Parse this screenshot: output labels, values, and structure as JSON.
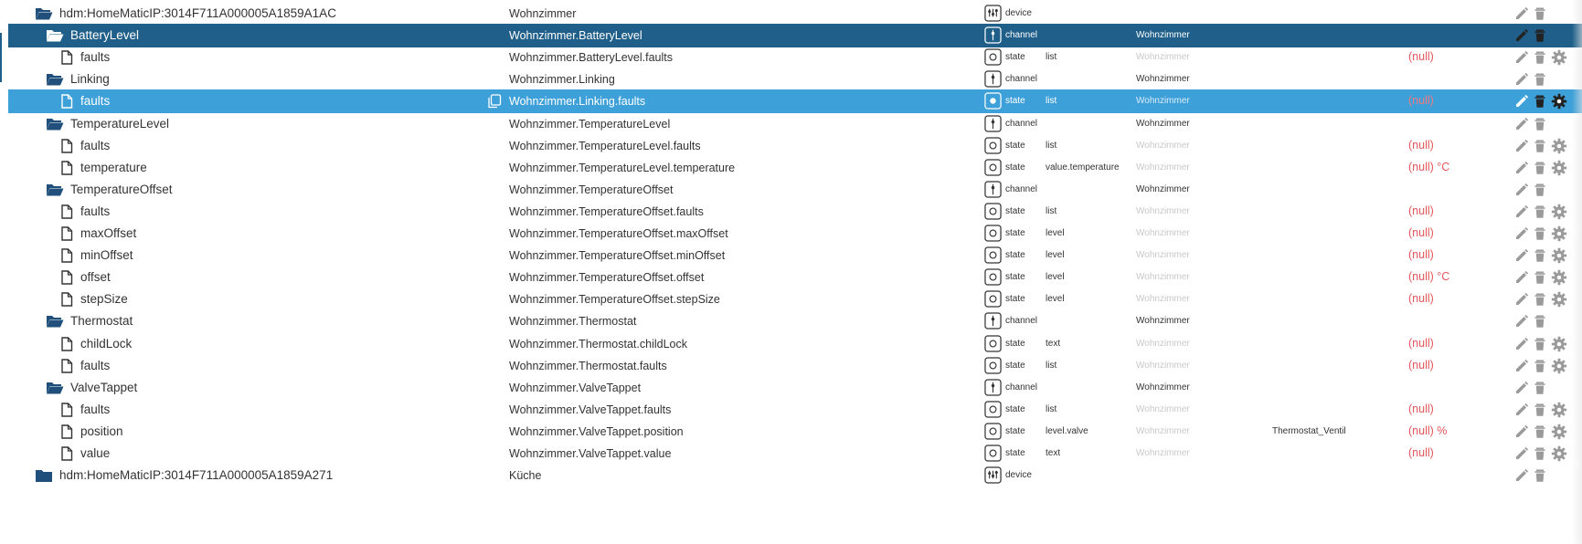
{
  "colors": {
    "selected_dark": "#1f5f89",
    "selected_light": "#3ea0d8",
    "folder": "#1f4f7a",
    "null_value": "#e3565a",
    "muted_icon": "#9a9a9a"
  },
  "rows": [
    {
      "kind": "device-open",
      "level": 0,
      "name": "hdm:HomeMaticIP:3014F711A000005A1859A1AC",
      "obj": "Wohnzimmer",
      "type": "device",
      "role": "",
      "room": "",
      "room_dim": false,
      "func": "",
      "value": "",
      "actions": "ed"
    },
    {
      "kind": "folder-open",
      "level": 1,
      "name": "BatteryLevel",
      "obj": "Wohnzimmer.BatteryLevel",
      "type": "channel",
      "role": "",
      "room": "Wohnzimmer",
      "room_dim": false,
      "func": "",
      "value": "",
      "actions": "ed",
      "selected": "dark"
    },
    {
      "kind": "file",
      "level": 2,
      "name": "faults",
      "obj": "Wohnzimmer.BatteryLevel.faults",
      "type": "state",
      "role": "list",
      "room": "Wohnzimmer",
      "room_dim": true,
      "func": "",
      "value": "(null)",
      "actions": "edg"
    },
    {
      "kind": "folder-open",
      "level": 1,
      "name": "Linking",
      "obj": "Wohnzimmer.Linking",
      "type": "channel",
      "role": "",
      "room": "Wohnzimmer",
      "room_dim": false,
      "func": "",
      "value": "",
      "actions": "ed"
    },
    {
      "kind": "file",
      "level": 2,
      "name": "faults",
      "obj": "Wohnzimmer.Linking.faults",
      "type": "state",
      "role": "list",
      "room": "Wohnzimmer",
      "room_dim": true,
      "func": "",
      "value": "(null)",
      "actions": "edg",
      "selected": "light",
      "copy": true
    },
    {
      "kind": "folder-open",
      "level": 1,
      "name": "TemperatureLevel",
      "obj": "Wohnzimmer.TemperatureLevel",
      "type": "channel",
      "role": "",
      "room": "Wohnzimmer",
      "room_dim": false,
      "func": "",
      "value": "",
      "actions": "ed"
    },
    {
      "kind": "file",
      "level": 2,
      "name": "faults",
      "obj": "Wohnzimmer.TemperatureLevel.faults",
      "type": "state",
      "role": "list",
      "room": "Wohnzimmer",
      "room_dim": true,
      "func": "",
      "value": "(null)",
      "actions": "edg"
    },
    {
      "kind": "file",
      "level": 2,
      "name": "temperature",
      "obj": "Wohnzimmer.TemperatureLevel.temperature",
      "type": "state",
      "role": "value.temperature",
      "room": "Wohnzimmer",
      "room_dim": true,
      "func": "",
      "value": "(null) °C",
      "actions": "edg"
    },
    {
      "kind": "folder-open",
      "level": 1,
      "name": "TemperatureOffset",
      "obj": "Wohnzimmer.TemperatureOffset",
      "type": "channel",
      "role": "",
      "room": "Wohnzimmer",
      "room_dim": false,
      "func": "",
      "value": "",
      "actions": "ed"
    },
    {
      "kind": "file",
      "level": 2,
      "name": "faults",
      "obj": "Wohnzimmer.TemperatureOffset.faults",
      "type": "state",
      "role": "list",
      "room": "Wohnzimmer",
      "room_dim": true,
      "func": "",
      "value": "(null)",
      "actions": "edg"
    },
    {
      "kind": "file",
      "level": 2,
      "name": "maxOffset",
      "obj": "Wohnzimmer.TemperatureOffset.maxOffset",
      "type": "state",
      "role": "level",
      "room": "Wohnzimmer",
      "room_dim": true,
      "func": "",
      "value": "(null)",
      "actions": "edg"
    },
    {
      "kind": "file",
      "level": 2,
      "name": "minOffset",
      "obj": "Wohnzimmer.TemperatureOffset.minOffset",
      "type": "state",
      "role": "level",
      "room": "Wohnzimmer",
      "room_dim": true,
      "func": "",
      "value": "(null)",
      "actions": "edg"
    },
    {
      "kind": "file",
      "level": 2,
      "name": "offset",
      "obj": "Wohnzimmer.TemperatureOffset.offset",
      "type": "state",
      "role": "level",
      "room": "Wohnzimmer",
      "room_dim": true,
      "func": "",
      "value": "(null) °C",
      "actions": "edg"
    },
    {
      "kind": "file",
      "level": 2,
      "name": "stepSize",
      "obj": "Wohnzimmer.TemperatureOffset.stepSize",
      "type": "state",
      "role": "level",
      "room": "Wohnzimmer",
      "room_dim": true,
      "func": "",
      "value": "(null)",
      "actions": "edg"
    },
    {
      "kind": "folder-open",
      "level": 1,
      "name": "Thermostat",
      "obj": "Wohnzimmer.Thermostat",
      "type": "channel",
      "role": "",
      "room": "Wohnzimmer",
      "room_dim": false,
      "func": "",
      "value": "",
      "actions": "ed"
    },
    {
      "kind": "file",
      "level": 2,
      "name": "childLock",
      "obj": "Wohnzimmer.Thermostat.childLock",
      "type": "state",
      "role": "text",
      "room": "Wohnzimmer",
      "room_dim": true,
      "func": "",
      "value": "(null)",
      "actions": "edg"
    },
    {
      "kind": "file",
      "level": 2,
      "name": "faults",
      "obj": "Wohnzimmer.Thermostat.faults",
      "type": "state",
      "role": "list",
      "room": "Wohnzimmer",
      "room_dim": true,
      "func": "",
      "value": "(null)",
      "actions": "edg"
    },
    {
      "kind": "folder-open",
      "level": 1,
      "name": "ValveTappet",
      "obj": "Wohnzimmer.ValveTappet",
      "type": "channel",
      "role": "",
      "room": "Wohnzimmer",
      "room_dim": false,
      "func": "",
      "value": "",
      "actions": "ed"
    },
    {
      "kind": "file",
      "level": 2,
      "name": "faults",
      "obj": "Wohnzimmer.ValveTappet.faults",
      "type": "state",
      "role": "list",
      "room": "Wohnzimmer",
      "room_dim": true,
      "func": "",
      "value": "(null)",
      "actions": "edg"
    },
    {
      "kind": "file",
      "level": 2,
      "name": "position",
      "obj": "Wohnzimmer.ValveTappet.position",
      "type": "state",
      "role": "level.valve",
      "room": "Wohnzimmer",
      "room_dim": true,
      "func": "Thermostat_Ventil",
      "value": "(null) %",
      "actions": "edg"
    },
    {
      "kind": "file",
      "level": 2,
      "name": "value",
      "obj": "Wohnzimmer.ValveTappet.value",
      "type": "state",
      "role": "text",
      "room": "Wohnzimmer",
      "room_dim": true,
      "func": "",
      "value": "(null)",
      "actions": "edg"
    },
    {
      "kind": "device-closed",
      "level": 0,
      "name": "hdm:HomeMaticIP:3014F711A000005A1859A271",
      "obj": "Küche",
      "type": "device",
      "role": "",
      "room": "",
      "room_dim": false,
      "func": "",
      "value": "",
      "actions": "ed"
    }
  ]
}
